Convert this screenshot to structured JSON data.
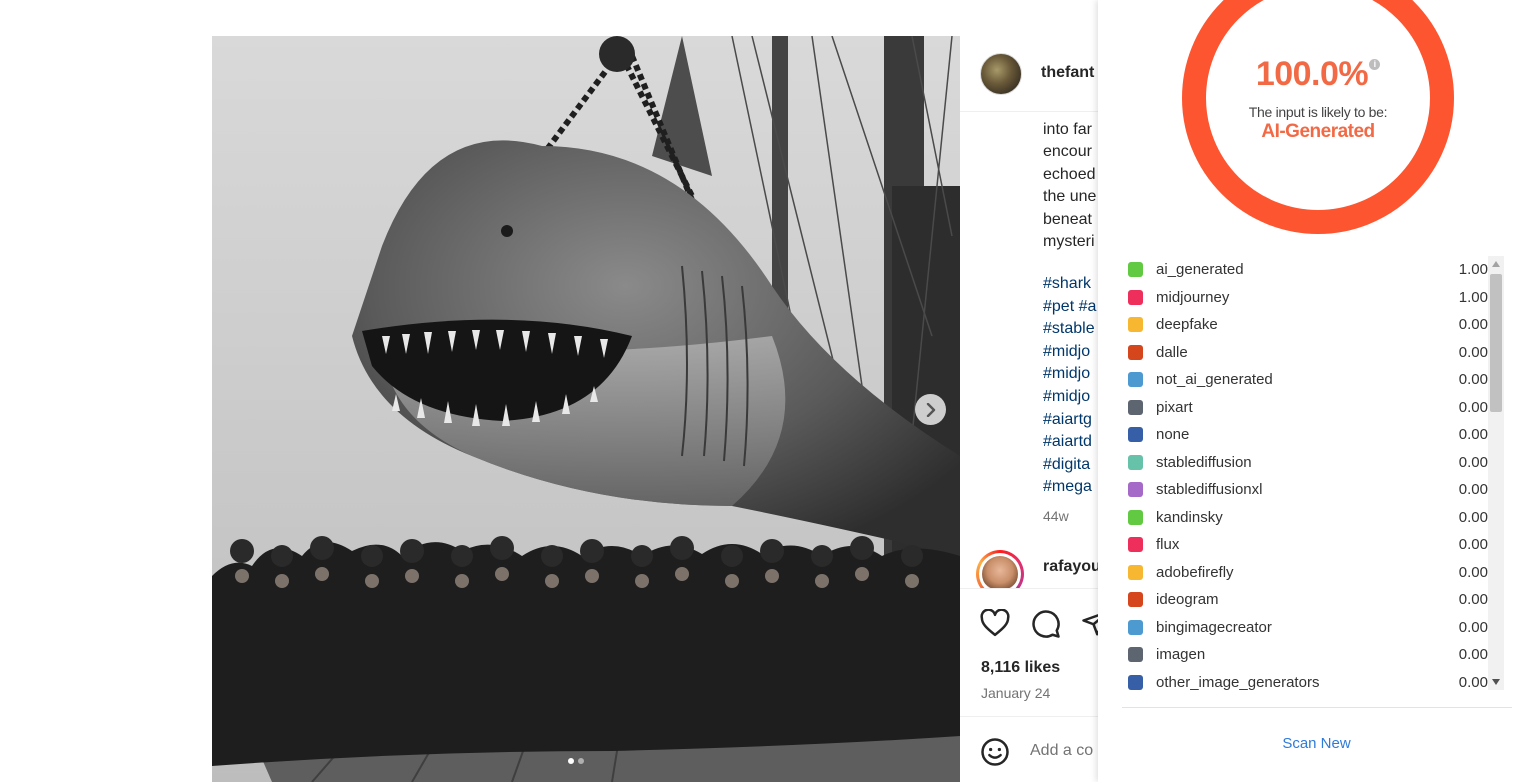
{
  "post": {
    "username": "thefant",
    "caption_lines": [
      "into far",
      "encour",
      "echoed",
      "the une",
      "beneat",
      "mysteri"
    ],
    "hashtags": [
      "#shark",
      "#pet #a",
      "#stable",
      "#midjo",
      "#midjo",
      "#midjo",
      "#aiartg",
      "#aiartd",
      "#digita",
      "#mega"
    ],
    "time_ago": "44w",
    "commenter": "rafayou",
    "likes": "8,116 likes",
    "date": "January 24",
    "add_comment_placeholder": "Add a co",
    "carousel": {
      "slides": 2,
      "active": 0
    }
  },
  "detector": {
    "percentage": "100.0%",
    "info_glyph": "i",
    "likely_text": "The input is likely to be:",
    "verdict": "AI-Generated",
    "accent_color": "#f26a45",
    "ring_color": "#fd5530",
    "ring_fraction": 1.0,
    "classes": [
      {
        "label": "ai_generated",
        "value": "1.00",
        "color": "#62c942"
      },
      {
        "label": "midjourney",
        "value": "1.00",
        "color": "#ee2f5b"
      },
      {
        "label": "deepfake",
        "value": "0.00",
        "color": "#f7b731"
      },
      {
        "label": "dalle",
        "value": "0.00",
        "color": "#d6461c"
      },
      {
        "label": "not_ai_generated",
        "value": "0.00",
        "color": "#4c9ad0"
      },
      {
        "label": "pixart",
        "value": "0.00",
        "color": "#5d6571"
      },
      {
        "label": "none",
        "value": "0.00",
        "color": "#365fa8"
      },
      {
        "label": "stablediffusion",
        "value": "0.00",
        "color": "#66c2a9"
      },
      {
        "label": "stablediffusionxl",
        "value": "0.00",
        "color": "#a569c7"
      },
      {
        "label": "kandinsky",
        "value": "0.00",
        "color": "#62c942"
      },
      {
        "label": "flux",
        "value": "0.00",
        "color": "#ee2f5b"
      },
      {
        "label": "adobefirefly",
        "value": "0.00",
        "color": "#f7b731"
      },
      {
        "label": "ideogram",
        "value": "0.00",
        "color": "#d6461c"
      },
      {
        "label": "bingimagecreator",
        "value": "0.00",
        "color": "#4c9ad0"
      },
      {
        "label": "imagen",
        "value": "0.00",
        "color": "#5d6571"
      },
      {
        "label": "other_image_generators",
        "value": "0.00",
        "color": "#365fa8"
      }
    ],
    "scan_new_label": "Scan New"
  }
}
